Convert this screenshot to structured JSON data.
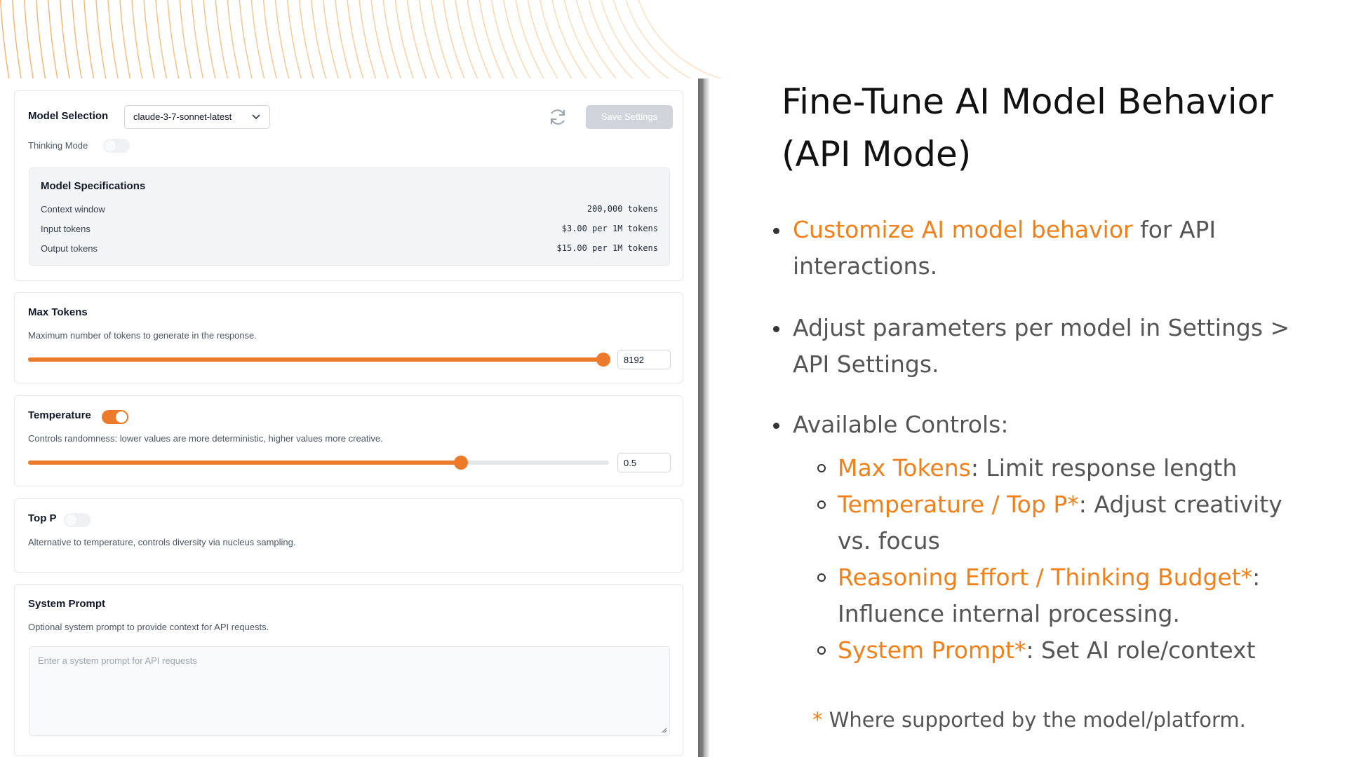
{
  "settings": {
    "model_selection_label": "Model Selection",
    "model_value": "claude-3-7-sonnet-latest",
    "save_label": "Save Settings",
    "thinking_mode_label": "Thinking Mode",
    "thinking_mode_on": false,
    "specs": {
      "title": "Model Specifications",
      "rows": [
        {
          "key": "Context window",
          "value": "200,000 tokens"
        },
        {
          "key": "Input tokens",
          "value": "$3.00 per 1M tokens"
        },
        {
          "key": "Output tokens",
          "value": "$15.00 per 1M tokens"
        }
      ]
    },
    "max_tokens": {
      "label": "Max Tokens",
      "description": "Maximum number of tokens to generate in the response.",
      "value": "8192",
      "slider_fraction": 1.0
    },
    "temperature": {
      "label": "Temperature",
      "enabled": true,
      "description": "Controls randomness: lower values are more deterministic, higher values more creative.",
      "value": "0.5",
      "slider_fraction": 0.745
    },
    "top_p": {
      "label": "Top P",
      "enabled": false,
      "description": "Alternative to temperature, controls diversity via nucleus sampling."
    },
    "system_prompt": {
      "label": "System Prompt",
      "description": "Optional system prompt to provide context for API requests.",
      "placeholder": "Enter a system prompt for API requests"
    },
    "accent_color": "#ec7a2a"
  },
  "slide": {
    "title_line1": "Fine-Tune AI Model Behavior",
    "title_line2": "(API Mode)",
    "bullet1_highlight": "Customize AI model behavior",
    "bullet1_rest": " for API interactions.",
    "bullet2": "Adjust parameters per model in Settings > API Settings.",
    "bullet3": "Available Controls:",
    "controls": [
      {
        "highlight": "Max Tokens",
        "rest": ": Limit response length"
      },
      {
        "highlight": "Temperature / Top P*",
        "rest": ": Adjust creativity vs. focus"
      },
      {
        "highlight": "Reasoning Effort / Thinking Budget*",
        "rest": ": Influence internal processing."
      },
      {
        "highlight": "System Prompt*",
        "rest": ": Set AI role/context"
      }
    ],
    "footnote_star": "*",
    "footnote_text": " Where supported by the model/platform.",
    "highlight_color": "#f08019"
  }
}
